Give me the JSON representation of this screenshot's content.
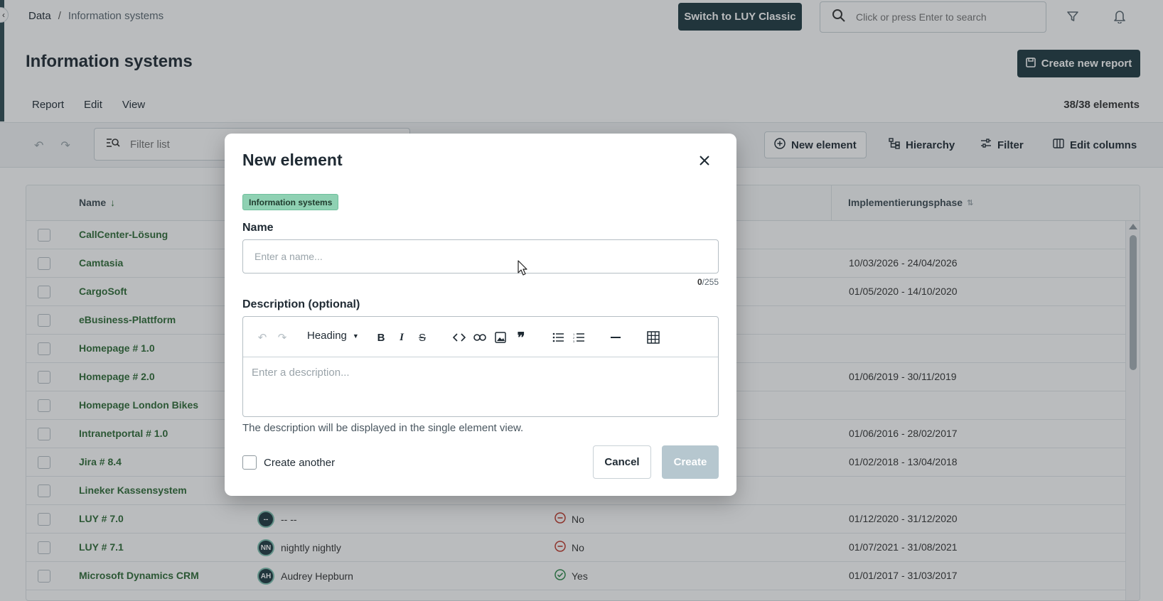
{
  "breadcrumb": {
    "root": "Data",
    "separator": "/",
    "current": "Information systems"
  },
  "header": {
    "switch_label": "Switch to LUY Classic",
    "search_placeholder": "Click or press Enter to search",
    "icons": [
      "search-icon",
      "filter-icon",
      "bell-icon"
    ]
  },
  "page": {
    "title": "Information systems",
    "create_report_label": "Create new report",
    "menu": [
      "Report",
      "Edit",
      "View"
    ],
    "elements_count": "38/38 elements"
  },
  "toolbar": {
    "filter_placeholder": "Filter list",
    "new_element_label": "New element",
    "hierarchy_label": "Hierarchy",
    "filter_label": "Filter",
    "edit_columns_label": "Edit columns"
  },
  "table": {
    "columns": {
      "name": "Name",
      "phase": "Implementierungsphase"
    },
    "rows": [
      {
        "name": "CallCenter-Lösung",
        "phase": ""
      },
      {
        "name": "Camtasia",
        "phase": "10/03/2026 - 24/04/2026"
      },
      {
        "name": "CargoSoft",
        "phase": "01/05/2020 - 14/10/2020"
      },
      {
        "name": "eBusiness-Plattform",
        "phase": ""
      },
      {
        "name": "Homepage # 1.0",
        "phase": ""
      },
      {
        "name": "Homepage # 2.0",
        "phase": "01/06/2019 - 30/11/2019"
      },
      {
        "name": "Homepage London Bikes",
        "phase": ""
      },
      {
        "name": "Intranetportal # 1.0",
        "phase": "01/06/2016 - 28/02/2017"
      },
      {
        "name": "Jira # 8.4",
        "phase": "01/02/2018 - 13/04/2018"
      },
      {
        "name": "Lineker Kassensystem",
        "phase": ""
      },
      {
        "name": "LUY # 7.0",
        "initials": "--",
        "responsible": "-- --",
        "status": "No",
        "phase": "01/12/2020 - 31/12/2020"
      },
      {
        "name": "LUY # 7.1",
        "initials": "NN",
        "responsible": "nightly nightly",
        "status": "No",
        "phase": "01/07/2021 - 31/08/2021"
      },
      {
        "name": "Microsoft Dynamics CRM",
        "initials": "AH",
        "responsible": "Audrey Hepburn",
        "status": "Yes",
        "phase": "01/01/2017 - 31/03/2017"
      }
    ]
  },
  "modal": {
    "title": "New element",
    "tag": "Information systems",
    "name_label": "Name",
    "name_placeholder": "Enter a name...",
    "counter_current": "0",
    "counter_max": "/255",
    "description_label": "Description (optional)",
    "heading_select": "Heading",
    "description_placeholder": "Enter a description...",
    "hint": "The description will be displayed in the single element view.",
    "create_another": "Create another",
    "cancel": "Cancel",
    "create": "Create"
  },
  "colors": {
    "primary": "#1e3940",
    "accent_green": "#2e6b36",
    "tag_bg": "#8fd1b3",
    "disabled_btn": "#b6c7cf"
  }
}
